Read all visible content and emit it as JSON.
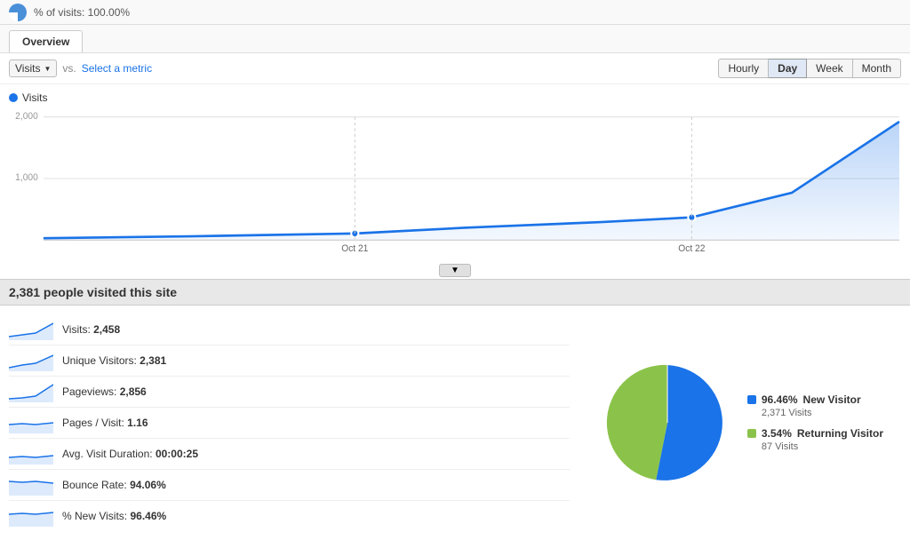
{
  "topbar": {
    "percent_text": "% of visits: 100.00%"
  },
  "tab": {
    "label": "Overview"
  },
  "toolbar": {
    "metric_label": "Visits",
    "vs_text": "vs.",
    "select_metric_label": "Select a metric",
    "time_buttons": [
      "Hourly",
      "Day",
      "Week",
      "Month"
    ],
    "active_time": "Day"
  },
  "chart": {
    "y_labels": [
      "2,000",
      "1,000"
    ],
    "x_labels": [
      "Oct 21",
      "Oct 22"
    ],
    "legend_label": "Visits"
  },
  "summary": {
    "headline": "2,381 people visited this site"
  },
  "stats": [
    {
      "label": "Visits:",
      "value": "2,458"
    },
    {
      "label": "Unique Visitors:",
      "value": "2,381"
    },
    {
      "label": "Pageviews:",
      "value": "2,856"
    },
    {
      "label": "Pages / Visit:",
      "value": "1.16"
    },
    {
      "label": "Avg. Visit Duration:",
      "value": "00:00:25"
    },
    {
      "label": "Bounce Rate:",
      "value": "94.06%"
    },
    {
      "label": "% New Visits:",
      "value": "96.46%"
    }
  ],
  "pie": {
    "new_visitor_pct": "96.46%",
    "new_visitor_label": "New Visitor",
    "new_visitor_visits": "2,371 Visits",
    "returning_visitor_pct": "3.54%",
    "returning_visitor_label": "Returning Visitor",
    "returning_visitor_visits": "87 Visits",
    "color_new": "#1a73e8",
    "color_returning": "#8bc34a"
  }
}
